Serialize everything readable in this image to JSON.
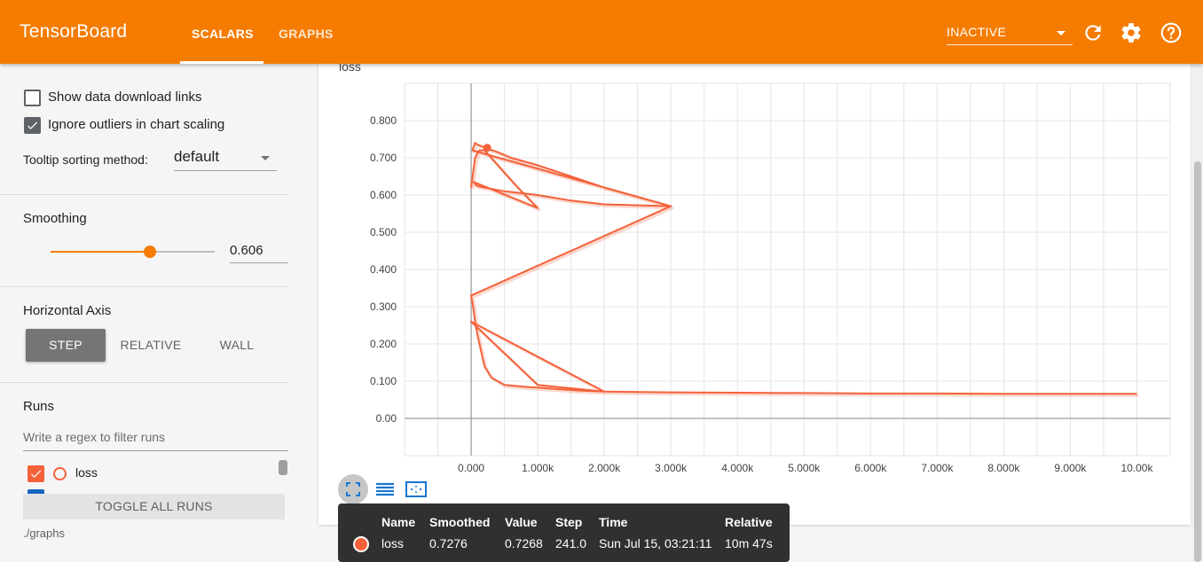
{
  "header": {
    "brand": "TensorBoard",
    "tabs": [
      {
        "label": "SCALARS",
        "active": true
      },
      {
        "label": "GRAPHS",
        "active": false
      }
    ],
    "run_status": "INACTIVE",
    "accent_color": "#f57c00",
    "icons": [
      "refresh-icon",
      "settings-gear-icon",
      "help-icon"
    ]
  },
  "sidebar": {
    "options": [
      {
        "label": "Show data download links",
        "checked": false
      },
      {
        "label": "Ignore outliers in chart scaling",
        "checked": true
      }
    ],
    "tooltip_sorting": {
      "label": "Tooltip sorting method:",
      "value": "default"
    },
    "smoothing": {
      "title": "Smoothing",
      "value": "0.606",
      "slider_fraction": 0.606
    },
    "horizontal_axis": {
      "title": "Horizontal Axis",
      "options": [
        "STEP",
        "RELATIVE",
        "WALL"
      ],
      "selected": "STEP"
    },
    "runs": {
      "title": "Runs",
      "filter_placeholder": "Write a regex to filter runs",
      "items": [
        {
          "name": "loss",
          "checked": true,
          "color": "#f4623a"
        }
      ],
      "toggle_all_label": "TOGGLE ALL RUNS",
      "logdir": "./graphs"
    }
  },
  "chart": {
    "title": "loss",
    "toolbar_icons": [
      "fit-domain-icon",
      "toggle-log-scale-icon",
      "zoom-selection-icon"
    ]
  },
  "chart_data": {
    "type": "line",
    "title": "loss",
    "xlabel": "",
    "ylabel": "",
    "xlim": [
      -1000,
      10500
    ],
    "ylim": [
      -0.1,
      0.9
    ],
    "x_ticks": [
      "0.000",
      "1.000k",
      "2.000k",
      "3.000k",
      "4.000k",
      "5.000k",
      "6.000k",
      "7.000k",
      "8.000k",
      "9.000k",
      "10.00k"
    ],
    "y_ticks": [
      "0.00",
      "0.100",
      "0.200",
      "0.300",
      "0.400",
      "0.500",
      "0.600",
      "0.700",
      "0.800"
    ],
    "grid": true,
    "series": [
      {
        "name": "loss",
        "color": "#f4623a",
        "x": [
          0,
          60,
          120,
          200,
          400,
          700,
          1000,
          40,
          80,
          200,
          500,
          1000,
          1500,
          2000,
          3000,
          20,
          60,
          100,
          200,
          400,
          600,
          1000,
          1500,
          2000,
          3000,
          0,
          30,
          60,
          100,
          150,
          200,
          300,
          500,
          800,
          1200,
          1600,
          2000,
          0,
          1000,
          2000,
          3000,
          4000,
          5000,
          6000,
          7000,
          8000,
          9000,
          10000
        ],
        "y": [
          0.62,
          0.7,
          0.72,
          0.72,
          0.68,
          0.62,
          0.565,
          0.635,
          0.625,
          0.62,
          0.61,
          0.6,
          0.585,
          0.575,
          0.57,
          0.72,
          0.74,
          0.735,
          0.728,
          0.715,
          0.7,
          0.68,
          0.65,
          0.62,
          0.57,
          0.33,
          0.3,
          0.26,
          0.22,
          0.18,
          0.14,
          0.11,
          0.09,
          0.085,
          0.08,
          0.075,
          0.072,
          0.26,
          0.09,
          0.072,
          0.07,
          0.069,
          0.068,
          0.067,
          0.067,
          0.066,
          0.066,
          0.066
        ]
      }
    ],
    "highlight_point": {
      "step": 241.0,
      "value": 0.7268
    }
  },
  "tooltip": {
    "headers": [
      "Name",
      "Smoothed",
      "Value",
      "Step",
      "Time",
      "Relative"
    ],
    "row": {
      "name": "loss",
      "smoothed": "0.7276",
      "value": "0.7268",
      "step": "241.0",
      "time": "Sun Jul 15, 03:21:11",
      "relative": "10m 47s"
    }
  }
}
